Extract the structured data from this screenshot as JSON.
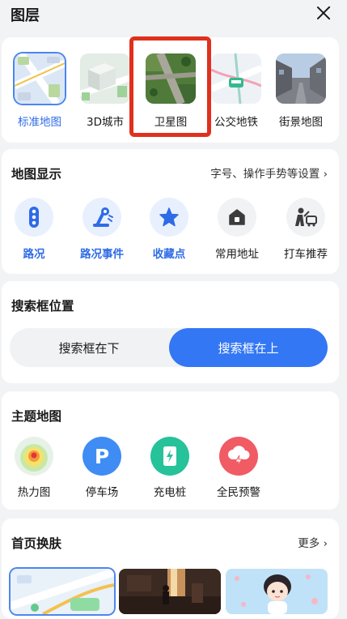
{
  "header": {
    "title": "图层"
  },
  "map_types": [
    {
      "label": "标准地图",
      "icon": "standard-map-thumbnail",
      "active": true
    },
    {
      "label": "3D城市",
      "icon": "3d-city-thumbnail",
      "active": false
    },
    {
      "label": "卫星图",
      "icon": "satellite-map-thumbnail",
      "active": false
    },
    {
      "label": "公交地铁",
      "icon": "transit-map-thumbnail",
      "active": false
    },
    {
      "label": "街景地图",
      "icon": "street-view-thumbnail",
      "active": false
    }
  ],
  "display": {
    "title": "地图显示",
    "settings_link": "字号、操作手势等设置",
    "options": [
      {
        "label": "路况",
        "icon": "traffic-light-icon",
        "on": true
      },
      {
        "label": "路况事件",
        "icon": "road-event-icon",
        "on": true
      },
      {
        "label": "收藏点",
        "icon": "star-icon",
        "on": true
      },
      {
        "label": "常用地址",
        "icon": "home-icon",
        "on": false
      },
      {
        "label": "打车推荐",
        "icon": "taxi-recommend-icon",
        "on": false
      }
    ]
  },
  "search_position": {
    "title": "搜索框位置",
    "options": [
      "搜索框在下",
      "搜索框在上"
    ],
    "selected": "搜索框在上"
  },
  "theme_maps": {
    "title": "主题地图",
    "items": [
      {
        "label": "热力图",
        "icon": "heatmap-icon"
      },
      {
        "label": "停车场",
        "icon": "parking-icon",
        "glyph": "P"
      },
      {
        "label": "充电桩",
        "icon": "charging-pile-icon"
      },
      {
        "label": "全民预警",
        "icon": "weather-alert-icon"
      }
    ]
  },
  "skins": {
    "title": "首页换肤",
    "more_link": "更多",
    "items": [
      {
        "name": "default-map-skin-thumbnail"
      },
      {
        "name": "film-scene-skin-thumbnail"
      },
      {
        "name": "cartoon-character-skin-thumbnail"
      }
    ]
  },
  "colors": {
    "accent": "#3377f4",
    "active_text": "#2e6be6",
    "highlight": "#e0301e",
    "background": "#f2f3f5"
  }
}
